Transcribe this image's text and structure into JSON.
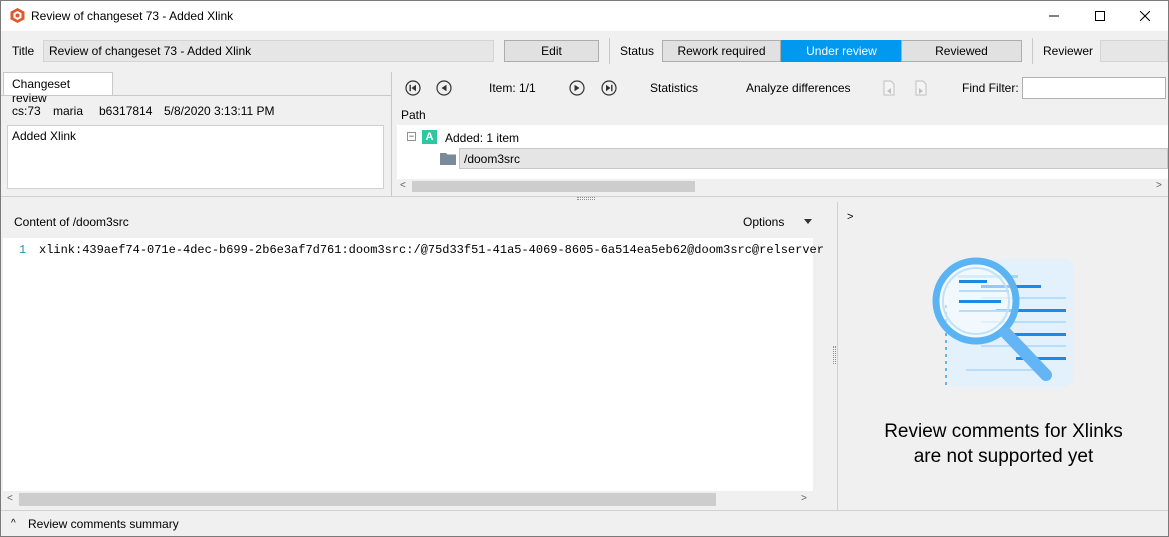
{
  "window": {
    "title": "Review of changeset 73 - Added Xlink",
    "minimize": "—",
    "maximize": "☐",
    "close": "✕"
  },
  "header": {
    "title_label": "Title",
    "title_value": "Review of changeset 73 - Added Xlink",
    "edit_label": "Edit",
    "status_label": "Status",
    "status_options": [
      "Rework required",
      "Under review",
      "Reviewed"
    ],
    "reviewer_label": "Reviewer"
  },
  "changeset": {
    "tab_label": "Changeset review",
    "cs": "cs:73",
    "author": "maria",
    "hash": "b6317814",
    "date": "5/8/2020 3:13:11 PM",
    "comment": "Added Xlink"
  },
  "toolbar": {
    "item_label": "Item: 1/1",
    "statistics_label": "Statistics",
    "analyze_label": "Analyze differences",
    "find_filter_label": "Find Filter:",
    "find_filter_value": ""
  },
  "tree": {
    "path_header": "Path",
    "group_badge": "A",
    "group_label": "Added: 1 item",
    "item_label": "/doom3src",
    "collapse_glyph": "−"
  },
  "content": {
    "title": "Content of /doom3src",
    "options_label": "Options",
    "line_number": "1",
    "line_text": "xlink:439aef74-071e-4dec-b699-2b6e3af7d761:doom3src:/@75d33f51-41a5-4069-8605-6a514ea5eb62@doom3src@relserver"
  },
  "review": {
    "expand_glyph": ">",
    "message": "Review comments for Xlinks are not supported yet"
  },
  "footer": {
    "caret": "^",
    "label": "Review comments summary"
  },
  "colors": {
    "accent": "#0099f0",
    "badge_green": "#2fc6a0",
    "folder": "#7a8a9a"
  }
}
